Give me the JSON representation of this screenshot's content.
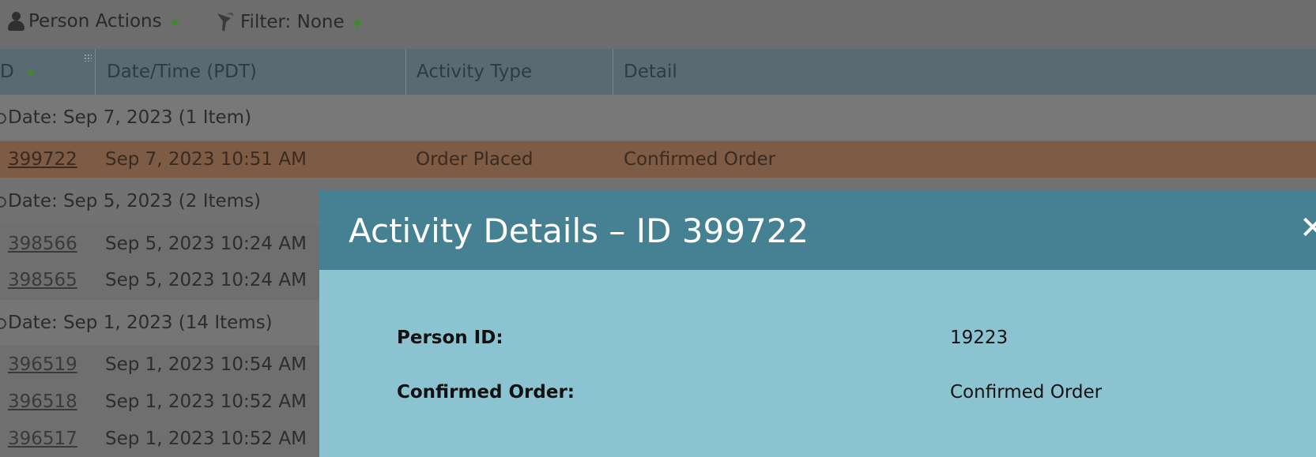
{
  "toolbar": {
    "person_actions": "Person Actions",
    "filter": "Filter: None"
  },
  "table": {
    "headers": {
      "id": "D",
      "datetime": "Date/Time (PDT)",
      "activity_type": "Activity Type",
      "detail": "Detail"
    },
    "groups": [
      {
        "label": "Date: Sep 7, 2023 (1 Item)"
      },
      {
        "label": "Date: Sep 5, 2023 (2 Items)"
      },
      {
        "label": "Date: Sep 1, 2023 (14 Items)"
      }
    ],
    "rows": [
      {
        "id": "399722",
        "datetime": "Sep 7, 2023 10:51 AM",
        "activity_type": "Order Placed",
        "detail": "Confirmed Order"
      },
      {
        "id": "398566",
        "datetime": "Sep 5, 2023 10:24 AM"
      },
      {
        "id": "398565",
        "datetime": "Sep 5, 2023 10:24 AM"
      },
      {
        "id": "396519",
        "datetime": "Sep 1, 2023 10:54 AM"
      },
      {
        "id": "396518",
        "datetime": "Sep 1, 2023 10:52 AM"
      },
      {
        "id": "396517",
        "datetime": "Sep 1, 2023 10:52 AM"
      }
    ]
  },
  "modal": {
    "title": "Activity Details – ID 399722",
    "close": "✕",
    "fields": [
      {
        "label": "Person ID:",
        "value": "19223"
      },
      {
        "label": "Confirmed Order:",
        "value": "Confirmed Order"
      }
    ]
  },
  "colors": {
    "selected_row": "#7e5b44",
    "modal_header": "#458193",
    "modal_body": "#8bc3d1",
    "dropdown_triangle": "#3d8a2e"
  },
  "icons": [
    "person-icon",
    "funnel-icon",
    "chevron-down-icon",
    "close-icon"
  ]
}
